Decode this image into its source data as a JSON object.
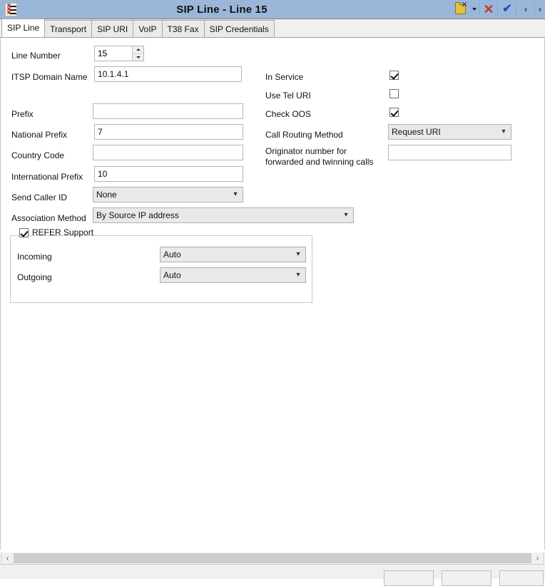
{
  "window": {
    "title": "SIP Line - Line 15",
    "menu_icon": "form-list-icon",
    "titlebar_color": "#9ab6d8",
    "actions": [
      {
        "name": "new-button",
        "icon": "new-record-icon",
        "label": ""
      },
      {
        "name": "new-dropdown-button",
        "icon": "chevron-down-icon",
        "label": ""
      },
      {
        "name": "delete-button",
        "icon": "red-x-icon",
        "label": "✕"
      },
      {
        "name": "validate-button",
        "icon": "blue-check-icon",
        "label": "✔"
      },
      {
        "name": "previous-record-button",
        "icon": "chevron-left-icon",
        "label": "‹"
      },
      {
        "name": "next-record-button",
        "icon": "chevron-right-icon",
        "label": "›"
      }
    ]
  },
  "tabs": [
    {
      "label": "SIP Line",
      "active": true
    },
    {
      "label": "Transport",
      "active": false
    },
    {
      "label": "SIP URI",
      "active": false
    },
    {
      "label": "VoIP",
      "active": false
    },
    {
      "label": "T38 Fax",
      "active": false
    },
    {
      "label": "SIP Credentials",
      "active": false
    }
  ],
  "left_column": {
    "line_number": {
      "label": "Line Number",
      "value": "15"
    },
    "itsp_domain_name": {
      "label": "ITSP Domain Name",
      "value": "10.1.4.1"
    },
    "prefix": {
      "label": "Prefix",
      "value": ""
    },
    "national_prefix": {
      "label": "National Prefix",
      "value": "7"
    },
    "country_code": {
      "label": "Country Code",
      "value": ""
    },
    "international_prefix": {
      "label": "International Prefix",
      "value": "10"
    },
    "send_caller_id": {
      "label": "Send Caller ID",
      "value": "None"
    },
    "association_method": {
      "label": "Association Method",
      "value": "By Source IP address"
    }
  },
  "right_column": {
    "in_service": {
      "label": "In Service",
      "checked": true
    },
    "use_tel_uri": {
      "label": "Use Tel URI",
      "checked": false
    },
    "check_oos": {
      "label": "Check OOS",
      "checked": true
    },
    "call_routing_method": {
      "label": "Call Routing Method",
      "value": "Request URI"
    },
    "originator_number": {
      "label": "Originator number for forwarded and twinning calls",
      "value": ""
    }
  },
  "refer_support": {
    "label": "REFER Support",
    "checked": true,
    "incoming": {
      "label": "Incoming",
      "value": "Auto"
    },
    "outgoing": {
      "label": "Outgoing",
      "value": "Auto"
    }
  },
  "scrollbar": {
    "left_arrow": "‹",
    "right_arrow": "›"
  },
  "footer_buttons": [
    {
      "name": "ok-button",
      "label": ""
    },
    {
      "name": "cancel-button",
      "label": ""
    },
    {
      "name": "help-button",
      "label": ""
    }
  ]
}
